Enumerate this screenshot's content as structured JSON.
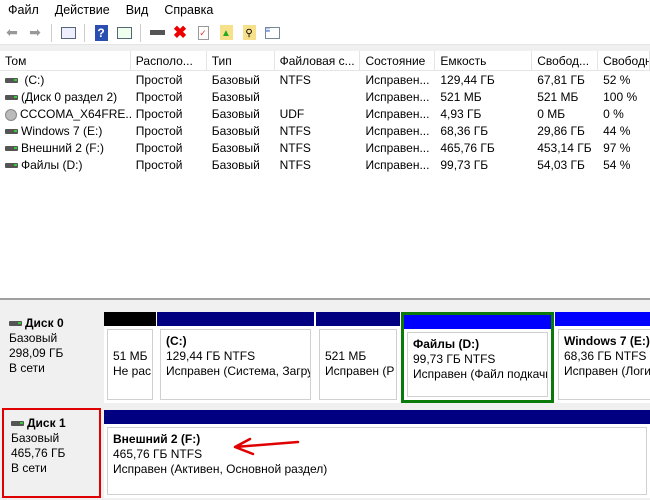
{
  "menu": [
    "Файл",
    "Действие",
    "Вид",
    "Справка"
  ],
  "toolbar_icons": [
    "back-icon",
    "forward-icon",
    "console-tree-icon",
    "help-icon",
    "action-pane-icon",
    "connect-drive-icon",
    "delete-icon",
    "properties-icon",
    "folder-up-icon",
    "folder-search-icon",
    "list-icon"
  ],
  "columns": [
    "Том",
    "Располо...",
    "Тип",
    "Файловая с...",
    "Состояние",
    "Емкость",
    "Свобод...",
    "Свободно"
  ],
  "volumes": [
    {
      "icon": "drive",
      "cells": [
        " (C:)",
        "Простой",
        "Базовый",
        "NTFS",
        "Исправен...",
        "129,44 ГБ",
        "67,81 ГБ",
        "52 %"
      ]
    },
    {
      "icon": "drive",
      "cells": [
        "(Диск 0 раздел 2)",
        "Простой",
        "Базовый",
        "",
        "Исправен...",
        "521 МБ",
        "521 МБ",
        "100 %"
      ]
    },
    {
      "icon": "cd",
      "cells": [
        "CCCOMA_X64FRE...",
        "Простой",
        "Базовый",
        "UDF",
        "Исправен...",
        "4,93 ГБ",
        "0 МБ",
        "0 %"
      ]
    },
    {
      "icon": "drive",
      "cells": [
        "Windows 7 (E:)",
        "Простой",
        "Базовый",
        "NTFS",
        "Исправен...",
        "68,36 ГБ",
        "29,86 ГБ",
        "44 %"
      ]
    },
    {
      "icon": "drive",
      "cells": [
        "Внешний 2 (F:)",
        "Простой",
        "Базовый",
        "NTFS",
        "Исправен...",
        "465,76 ГБ",
        "453,14 ГБ",
        "97 %"
      ]
    },
    {
      "icon": "drive",
      "cells": [
        "Файлы (D:)",
        "Простой",
        "Базовый",
        "NTFS",
        "Исправен...",
        "99,73 ГБ",
        "54,03 ГБ",
        "54 %"
      ]
    }
  ],
  "disks": [
    {
      "name": "Диск 0",
      "type": "Базовый",
      "size": "298,09 ГБ",
      "status": "В сети",
      "highlight": "",
      "partitions": [
        {
          "title": "",
          "line1": "51 МБ",
          "line2": "Не рас",
          "bar": "#000000"
        },
        {
          "title": " (C:)",
          "line1": "129,44 ГБ NTFS",
          "line2": "Исправен (Система, Загру",
          "bar": "#000080"
        },
        {
          "title": "",
          "line1": "521 МБ",
          "line2": "Исправен (Р",
          "bar": "#000080"
        },
        {
          "title": "Файлы  (D:)",
          "line1": "99,73 ГБ NTFS",
          "line2": "Исправен (Файл подкачк",
          "bar": "#0000ff",
          "selected": "#0a7a0a"
        },
        {
          "title": "Windows 7  (E:)",
          "line1": "68,36 ГБ NTFS",
          "line2": "Исправен (Логи",
          "bar": "#0000ff"
        }
      ]
    },
    {
      "name": "Диск 1",
      "type": "Базовый",
      "size": "465,76 ГБ",
      "status": "В сети",
      "highlight": "#e00000",
      "partitions": [
        {
          "title": "Внешний 2  (F:)",
          "line1": "465,76 ГБ NTFS",
          "line2": "Исправен (Активен, Основной раздел)",
          "bar": "#000080"
        }
      ]
    }
  ],
  "annotation_color": "#e00000"
}
